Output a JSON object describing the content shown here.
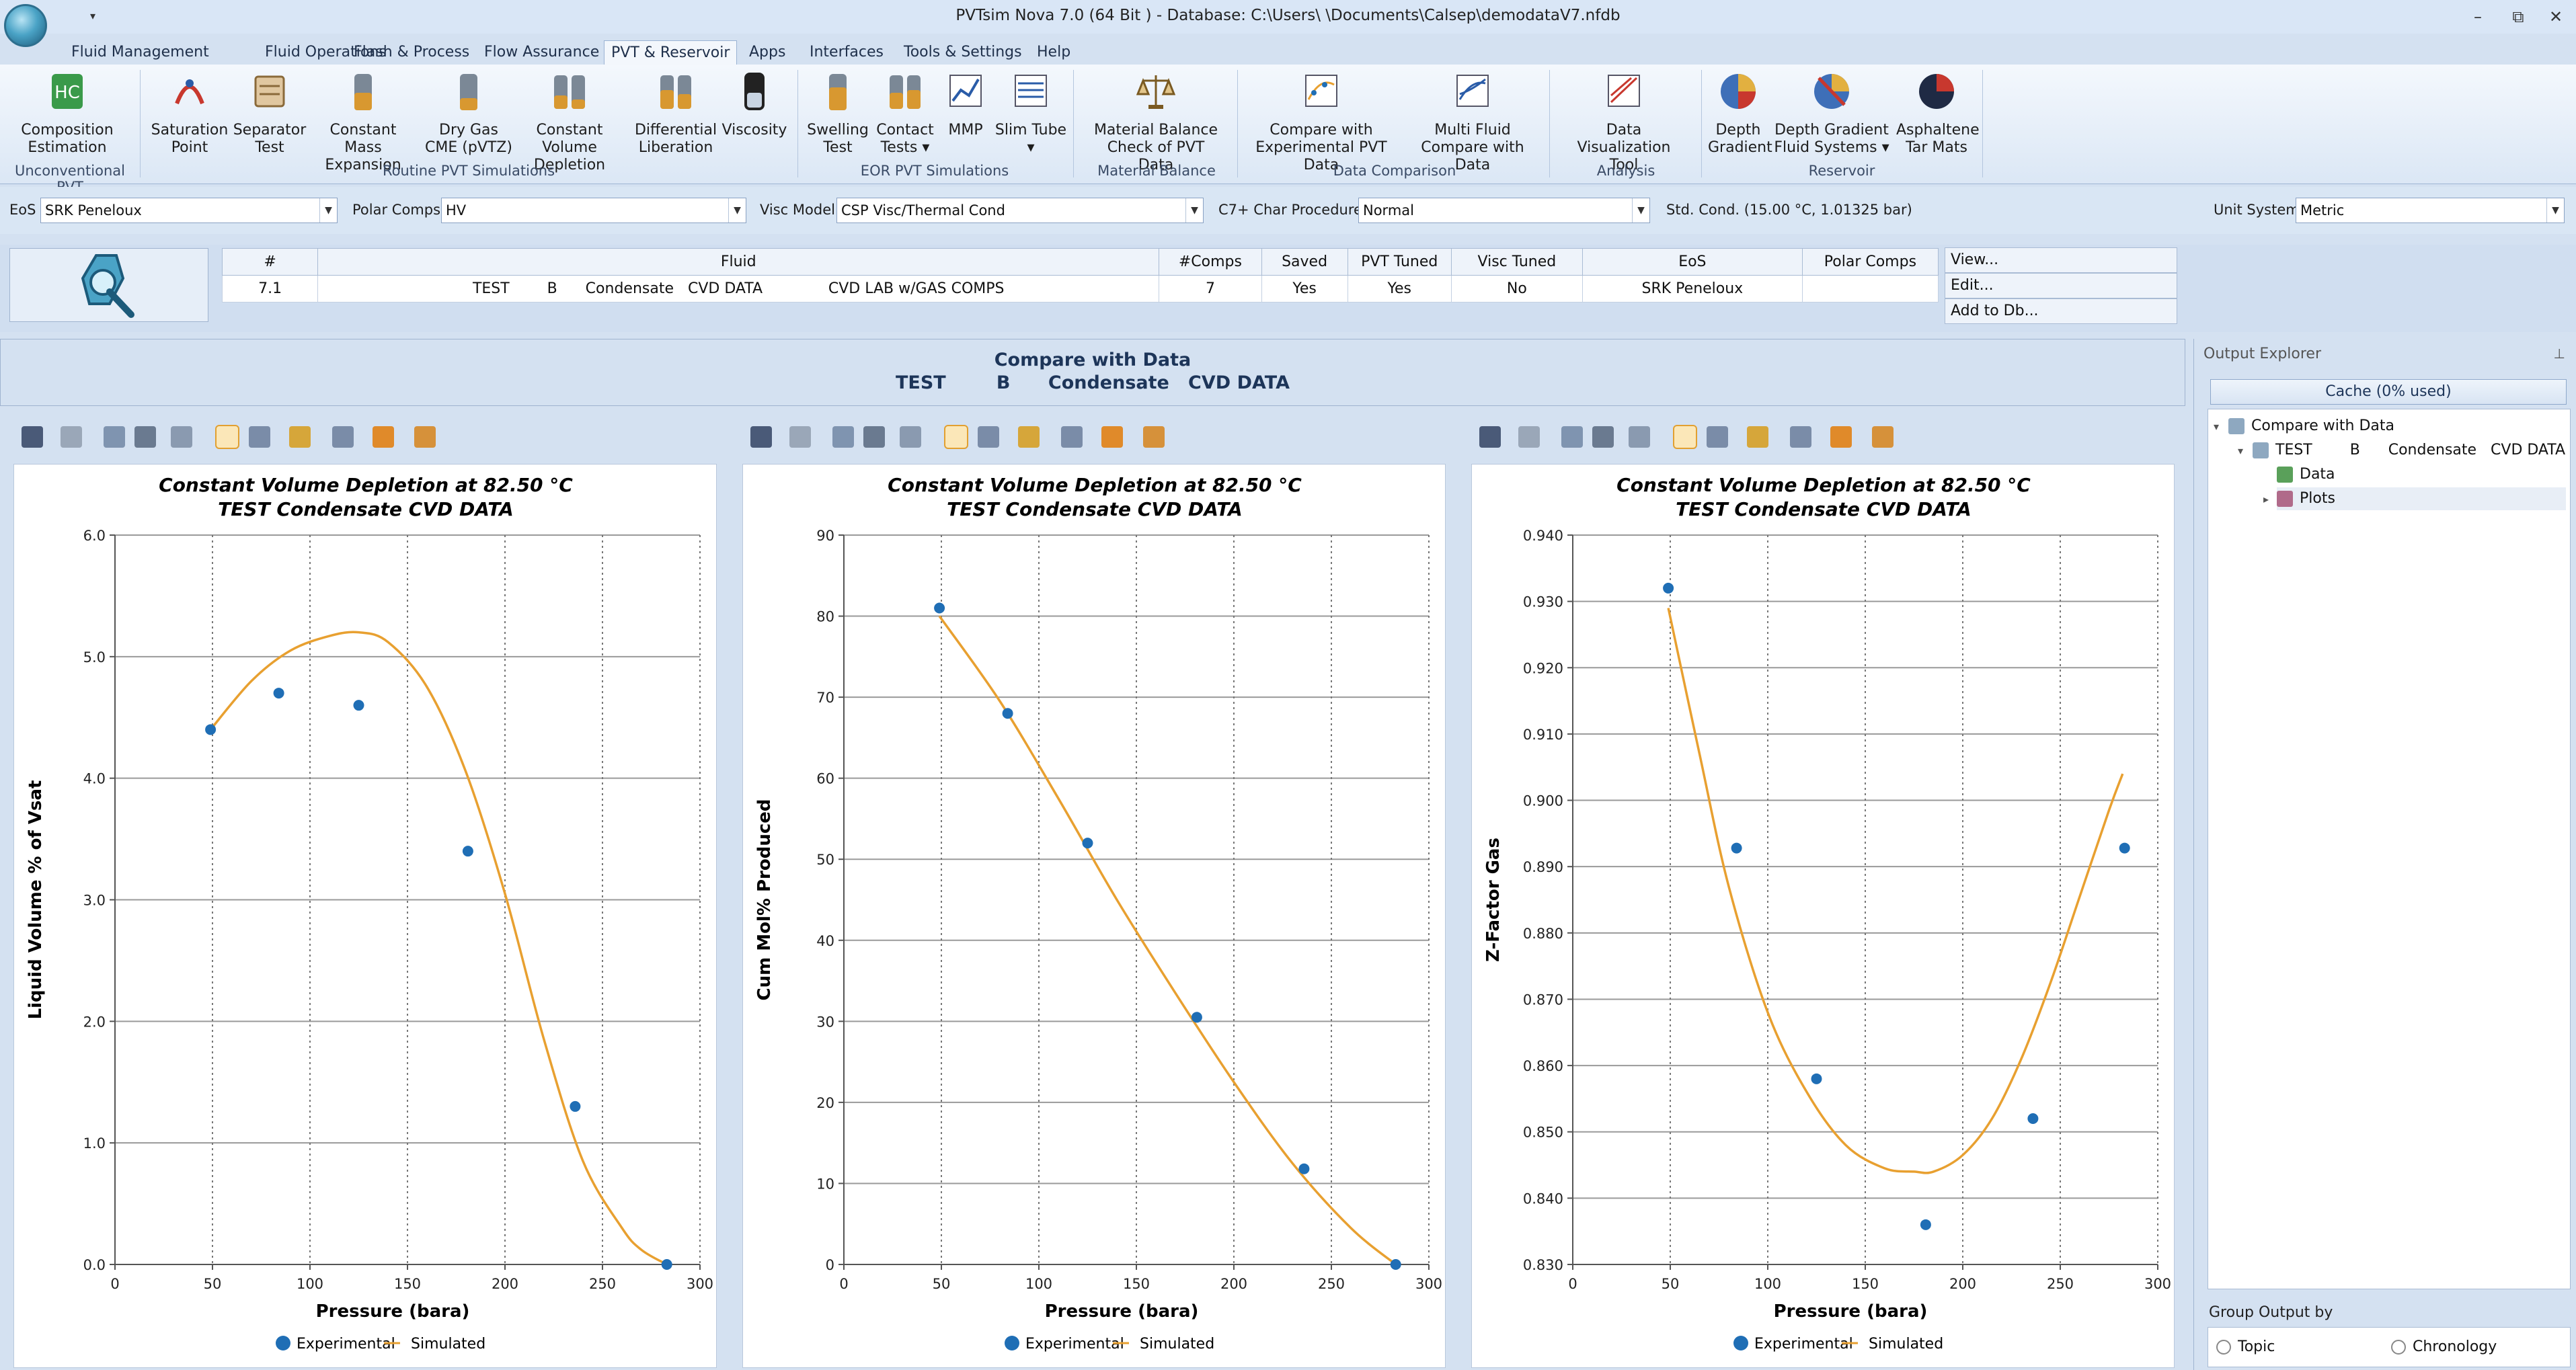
{
  "window": {
    "title": "PVTsim Nova 7.0 (64 Bit ) - Database: C:\\Users\\        \\Documents\\Calsep\\demodataV7.nfdb",
    "controls": [
      "–",
      "⧉",
      "✕"
    ]
  },
  "menu": [
    "Fluid Management",
    "Fluid Operations",
    "Flash & Process",
    "Flow Assurance",
    "PVT & Reservoir",
    "Apps",
    "Interfaces",
    "Tools & Settings",
    "Help"
  ],
  "menu_active": "PVT & Reservoir",
  "ribbon": {
    "buttons": [
      {
        "label": "Composition\nEstimation"
      },
      {
        "label": "Saturation\nPoint"
      },
      {
        "label": "Separator\nTest"
      },
      {
        "label": "Constant Mass\nExpansion"
      },
      {
        "label": "Dry Gas\nCME (pVTZ)"
      },
      {
        "label": "Constant Volume\nDepletion"
      },
      {
        "label": "Differential\nLiberation"
      },
      {
        "label": "Viscosity"
      },
      {
        "label": "Swelling\nTest"
      },
      {
        "label": "Contact\nTests ▾"
      },
      {
        "label": "MMP"
      },
      {
        "label": "Slim Tube\n▾"
      },
      {
        "label": "Material Balance\nCheck of PVT Data"
      },
      {
        "label": "Compare with\nExperimental PVT Data"
      },
      {
        "label": "Multi Fluid\nCompare with Data"
      },
      {
        "label": "Data Visualization\nTool"
      },
      {
        "label": "Depth\nGradient"
      },
      {
        "label": "Depth Gradient\nFluid Systems ▾"
      },
      {
        "label": "Asphaltene\nTar Mats"
      }
    ],
    "groups": [
      "Unconventional PVT",
      "Routine PVT Simulations",
      "EOR PVT Simulations",
      "Material Balance",
      "Data Comparison",
      "Analysis",
      "Reservoir"
    ]
  },
  "options": {
    "eos_label": "EoS",
    "eos_value": "SRK Peneloux",
    "polar_label": "Polar Comps",
    "polar_value": "HV",
    "visc_label": "Visc Model",
    "visc_value": "CSP Visc/Thermal Cond",
    "c7_label": "C7+ Char Procedure",
    "c7_value": "Normal",
    "std_cond": "Std. Cond. (15.00 °C, 1.01325 bar)",
    "unit_label": "Unit System",
    "unit_value": "Metric"
  },
  "fluid_table": {
    "headers": [
      "#",
      "Fluid",
      "#Comps",
      "Saved",
      "PVT Tuned",
      "Visc Tuned",
      "EoS",
      "Polar Comps"
    ],
    "row": [
      "7.1",
      "TEST        B      Condensate   CVD DATA              CVD LAB w/GAS COMPS",
      "7",
      "Yes",
      "Yes",
      "No",
      "SRK Peneloux",
      ""
    ]
  },
  "side_buttons": [
    "View...",
    "Edit...",
    "Add to Db..."
  ],
  "compare_header": {
    "title": "Compare with Data",
    "subtitle": "TEST        B      Condensate   CVD DATA"
  },
  "legend": {
    "experimental": "Experimental",
    "simulated": "Simulated"
  },
  "colors": {
    "experimental": "#1f6eb5",
    "simulated": "#e8a030"
  },
  "chart_data": [
    {
      "type": "scatter",
      "title": "Constant Volume Depletion at 82.50 °C",
      "subtitle": "TEST Condensate CVD DATA",
      "xlabel": "Pressure (bara)",
      "ylabel": "Liquid Volume % of Vsat",
      "xlim": [
        0,
        300
      ],
      "ylim": [
        0,
        6
      ],
      "xticks": [
        0,
        50,
        100,
        150,
        200,
        250,
        300
      ],
      "yticks": [
        0,
        1,
        2,
        3,
        4,
        5,
        6
      ],
      "ytick_labels": [
        "0.0",
        "1.0",
        "2.0",
        "3.0",
        "4.0",
        "5.0",
        "6.0"
      ],
      "series": [
        {
          "name": "Experimental",
          "kind": "points",
          "x": [
            49,
            84,
            125,
            181,
            236,
            283
          ],
          "y": [
            4.4,
            4.7,
            4.6,
            3.4,
            1.3,
            0.0
          ]
        },
        {
          "name": "Simulated",
          "kind": "line",
          "x": [
            49,
            70,
            90,
            110,
            125,
            140,
            160,
            180,
            200,
            220,
            240,
            260,
            270,
            283
          ],
          "y": [
            4.4,
            4.8,
            5.05,
            5.17,
            5.2,
            5.12,
            4.75,
            4.05,
            3.05,
            1.85,
            0.85,
            0.3,
            0.12,
            0.0
          ]
        }
      ]
    },
    {
      "type": "scatter",
      "title": "Constant Volume Depletion at 82.50 °C",
      "subtitle": "TEST Condensate CVD DATA",
      "xlabel": "Pressure (bara)",
      "ylabel": "Cum Mol% Produced",
      "xlim": [
        0,
        300
      ],
      "ylim": [
        0,
        90
      ],
      "xticks": [
        0,
        50,
        100,
        150,
        200,
        250,
        300
      ],
      "yticks": [
        0,
        10,
        20,
        30,
        40,
        50,
        60,
        70,
        80,
        90
      ],
      "ytick_labels": [
        "0",
        "10",
        "20",
        "30",
        "40",
        "50",
        "60",
        "70",
        "80",
        "90"
      ],
      "series": [
        {
          "name": "Experimental",
          "kind": "points",
          "x": [
            49,
            84,
            125,
            181,
            236,
            283
          ],
          "y": [
            81,
            68,
            52,
            30.5,
            11.8,
            0.0
          ]
        },
        {
          "name": "Simulated",
          "kind": "line",
          "x": [
            49,
            80,
            110,
            140,
            170,
            200,
            230,
            260,
            283
          ],
          "y": [
            80,
            69.5,
            57.5,
            45,
            33.5,
            22.5,
            12.5,
            4.5,
            0.0
          ]
        }
      ]
    },
    {
      "type": "scatter",
      "title": "Constant Volume Depletion at 82.50 °C",
      "subtitle": "TEST Condensate CVD DATA",
      "xlabel": "Pressure (bara)",
      "ylabel": "Z-Factor Gas",
      "xlim": [
        0,
        300
      ],
      "ylim": [
        0.83,
        0.94
      ],
      "xticks": [
        0,
        50,
        100,
        150,
        200,
        250,
        300
      ],
      "yticks": [
        0.83,
        0.84,
        0.85,
        0.86,
        0.87,
        0.88,
        0.89,
        0.9,
        0.91,
        0.92,
        0.93,
        0.94
      ],
      "ytick_labels": [
        "0.830",
        "0.840",
        "0.850",
        "0.860",
        "0.870",
        "0.880",
        "0.890",
        "0.900",
        "0.910",
        "0.920",
        "0.930",
        "0.940"
      ],
      "series": [
        {
          "name": "Experimental",
          "kind": "points",
          "x": [
            49,
            84,
            125,
            181,
            236,
            283
          ],
          "y": [
            0.932,
            0.8928,
            0.858,
            0.836,
            0.852,
            0.8928
          ]
        },
        {
          "name": "Simulated",
          "kind": "line",
          "x": [
            49,
            65,
            80,
            100,
            120,
            140,
            160,
            175,
            185,
            200,
            215,
            230,
            245,
            260,
            275,
            282
          ],
          "y": [
            0.929,
            0.907,
            0.887,
            0.868,
            0.856,
            0.848,
            0.8445,
            0.844,
            0.844,
            0.8465,
            0.852,
            0.861,
            0.8725,
            0.8855,
            0.8985,
            0.904
          ]
        }
      ]
    }
  ],
  "explorer": {
    "title": "Output Explorer",
    "cache": "Cache (0% used)",
    "tree": [
      "Compare with Data",
      "TEST        B      Condensate   CVD DATA",
      "Data",
      "Plots"
    ],
    "group_by_label": "Group Output by",
    "group_options": [
      "Topic",
      "Chronology"
    ]
  }
}
